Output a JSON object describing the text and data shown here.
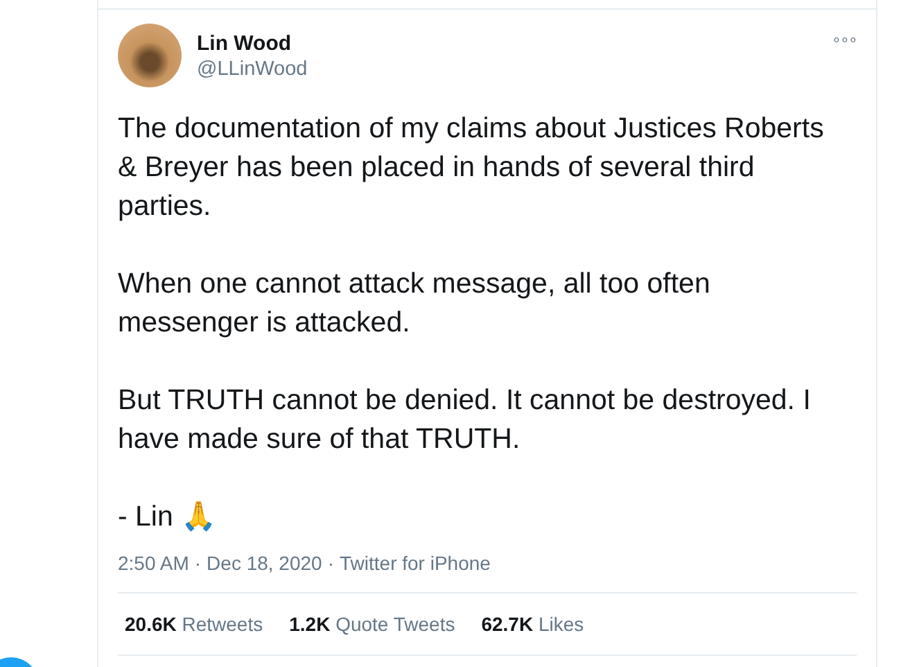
{
  "author": {
    "name": "Lin Wood",
    "handle": "@LLinWood"
  },
  "more_menu": "∘∘∘",
  "paragraphs": [
    "The documentation of my claims about Justices Roberts & Breyer has been placed in hands of several third parties.",
    "When one cannot attack message, all too often messenger is attacked.",
    "But TRUTH cannot be denied. It cannot be destroyed. I have made sure of that TRUTH.",
    "- Lin 🙏"
  ],
  "meta": {
    "time": "2:50 AM",
    "separator": "·",
    "date": "Dec 18, 2020",
    "source": "Twitter for iPhone"
  },
  "stats": [
    {
      "count": "20.6K",
      "label": "Retweets"
    },
    {
      "count": "1.2K",
      "label": "Quote Tweets"
    },
    {
      "count": "62.7K",
      "label": "Likes"
    }
  ]
}
